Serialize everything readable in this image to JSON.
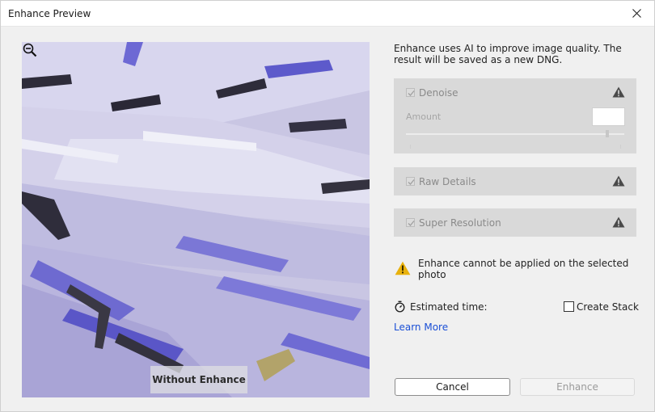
{
  "window": {
    "title": "Enhance Preview"
  },
  "preview": {
    "overlay_label": "Without Enhance",
    "zoom_icon": "zoom-out-icon"
  },
  "description": "Enhance uses AI to improve image quality. The result will be saved as a new DNG.",
  "options": [
    {
      "label": "Denoise",
      "checked": true,
      "disabled": true,
      "icon": "warning-icon"
    },
    {
      "label": "Raw Details",
      "checked": true,
      "disabled": true,
      "icon": "warning-icon"
    },
    {
      "label": "Super Resolution",
      "checked": true,
      "disabled": true,
      "icon": "warning-icon"
    }
  ],
  "denoise": {
    "amount_label": "Amount",
    "amount_value": ""
  },
  "warning": {
    "text": "Enhance cannot be applied on the selected photo",
    "icon": "warning-icon",
    "color": "#e8b10c"
  },
  "estimate": {
    "label": "Estimated time:",
    "icon": "stopwatch-icon"
  },
  "create_stack": {
    "label": "Create Stack",
    "checked": false
  },
  "learn_more": "Learn More",
  "buttons": {
    "cancel": "Cancel",
    "enhance": "Enhance"
  },
  "colors": {
    "link": "#1a4fd6",
    "panel": "#d9d9d9",
    "preview_base": "#c9c6e3"
  }
}
